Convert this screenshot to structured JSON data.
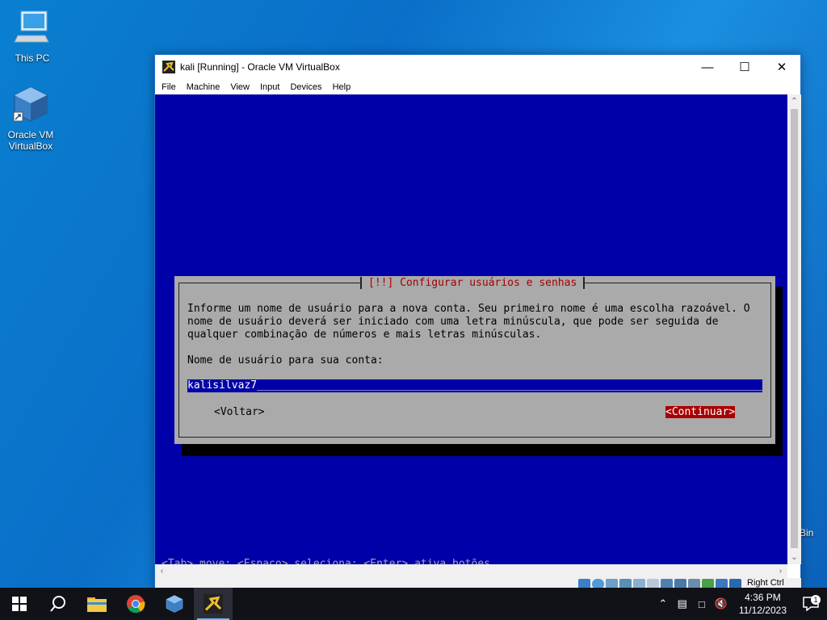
{
  "desktop": {
    "icons": [
      {
        "label": "This PC"
      },
      {
        "label": "Oracle VM\nVirtualBox"
      }
    ],
    "recycle_fragment": "Bin"
  },
  "window": {
    "title": "kali [Running] - Oracle VM VirtualBox",
    "menu": [
      "File",
      "Machine",
      "View",
      "Input",
      "Devices",
      "Help"
    ],
    "status_host_key": "Right Ctrl"
  },
  "installer": {
    "title": "[!!] Configurar usuários e senhas",
    "description": "Informe um nome de usuário para a nova conta. Seu primeiro nome é uma escolha razoável. O\nnome de usuário deverá ser iniciado com uma letra minúscula, que pode ser seguida de\nqualquer combinação de números e mais letras minúsculas.",
    "field_label": "Nome de usuário para sua conta:",
    "field_value": "kalisilvaz7",
    "field_fill": "_________________________________________________________________________________________________________",
    "back_button": "<Voltar>",
    "continue_button": "<Continuar>",
    "help_line": "<Tab> move; <Espaço> seleciona; <Enter> ativa botões"
  },
  "taskbar": {
    "time": "4:36 PM",
    "date": "11/12/2023",
    "notification_count": "1"
  },
  "colors": {
    "vm_background": "#0000a8",
    "dialog_gray": "#aaaaaa",
    "accent_red": "#a80000"
  }
}
